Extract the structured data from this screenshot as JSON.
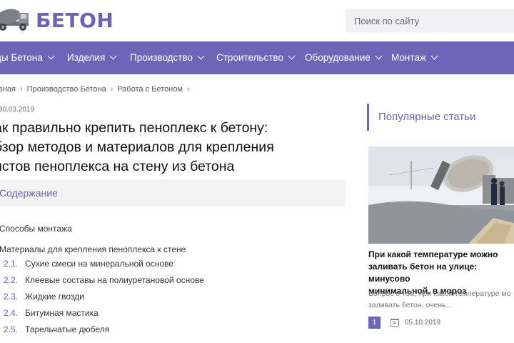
{
  "site": {
    "name": "БЕТОН",
    "logo_icon": "concrete-mixer-truck-icon"
  },
  "search": {
    "placeholder": "Поиск по сайту"
  },
  "nav": {
    "items": [
      {
        "label": "ды Бетона"
      },
      {
        "label": "Изделия"
      },
      {
        "label": "Производство"
      },
      {
        "label": "Строительство"
      },
      {
        "label": "Оборудование"
      },
      {
        "label": "Монтаж"
      }
    ]
  },
  "breadcrumb": [
    {
      "label": "вная"
    },
    {
      "label": "Производство Бетона"
    },
    {
      "label": "Работа с Бетоном"
    }
  ],
  "article": {
    "date": "30.03.2019",
    "title_lines": [
      "ак правильно крепить пеноплекс к бетону:",
      "бзор методов и материалов для крепления",
      "истов пеноплекса на стену из бетона"
    ]
  },
  "toc": {
    "title": "Содержание",
    "items": [
      {
        "num": "",
        "label": "Способы монтажа"
      },
      {
        "num": "",
        "label": "Материалы для крепления пеноплекса к стене"
      },
      {
        "num": "2.1.",
        "label": "Сухие смеси на минеральной основе"
      },
      {
        "num": "2.2.",
        "label": "Клеевые составы на полиуретановой основе"
      },
      {
        "num": "2.3.",
        "label": "Жидкие гвозди"
      },
      {
        "num": "2.4.",
        "label": "Битумная мастика"
      },
      {
        "num": "2.5.",
        "label": "Тарельчатые дюбеля"
      }
    ]
  },
  "sidebar": {
    "heading": "Популярные статьи",
    "article": {
      "title_lines": [
        "При какой температуре можно",
        "заливать бетон на улице: минусово",
        "минимальной, в мороз"
      ],
      "desc_lines": [
        "Вопрос о том, при какой температуре мо",
        "заливать бетон, очень..."
      ],
      "badge": "1",
      "date": "05.10.2019"
    }
  },
  "colors": {
    "accent": "#6d66b8"
  }
}
